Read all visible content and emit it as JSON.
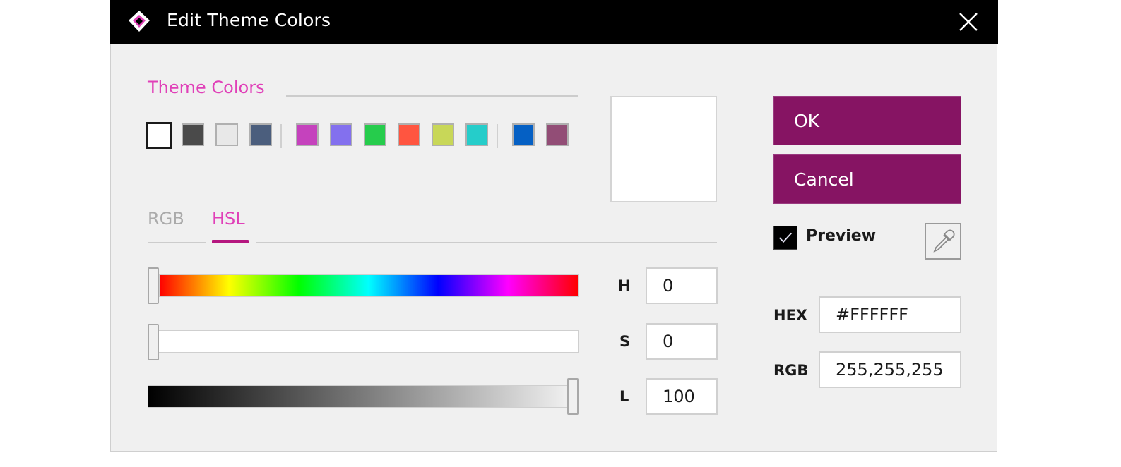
{
  "window": {
    "title": "Edit Theme Colors",
    "logo_icon": "diamond-logo-icon",
    "close_icon": "close-icon"
  },
  "theme_colors": {
    "label": "Theme Colors",
    "groups": [
      [
        {
          "name": "white",
          "color": "#FFFFFF",
          "selected": true
        },
        {
          "name": "dark-gray",
          "color": "#4A4A4A",
          "selected": false
        },
        {
          "name": "light-gray",
          "color": "#E8E8E8",
          "selected": false
        },
        {
          "name": "slate-blue",
          "color": "#4B5E7D",
          "selected": false
        }
      ],
      [
        {
          "name": "magenta",
          "color": "#C542BD",
          "selected": false
        },
        {
          "name": "lavender",
          "color": "#8370EE",
          "selected": false
        },
        {
          "name": "green",
          "color": "#26CC4C",
          "selected": false
        },
        {
          "name": "red-orange",
          "color": "#FF5540",
          "selected": false
        },
        {
          "name": "yellow-green",
          "color": "#C8D758",
          "selected": false
        },
        {
          "name": "turquoise",
          "color": "#25CDCA",
          "selected": false
        }
      ],
      [
        {
          "name": "blue",
          "color": "#0560C4",
          "selected": false
        },
        {
          "name": "plum",
          "color": "#924D76",
          "selected": false
        }
      ]
    ]
  },
  "preview_color": "#FFFFFF",
  "tabs": [
    {
      "label": "RGB",
      "active": false
    },
    {
      "label": "HSL",
      "active": true
    }
  ],
  "hsl": {
    "h": {
      "label": "H",
      "value": "0",
      "max": 360
    },
    "s": {
      "label": "S",
      "value": "0",
      "max": 100
    },
    "l": {
      "label": "L",
      "value": "100",
      "max": 100
    }
  },
  "buttons": {
    "ok": "OK",
    "cancel": "Cancel"
  },
  "preview_checkbox": {
    "label": "Preview",
    "checked": true
  },
  "eyedropper_icon": "eyedropper-icon",
  "hex": {
    "label": "HEX",
    "value": "#FFFFFF"
  },
  "rgb": {
    "label": "RGB",
    "value": "255,255,255"
  },
  "colors": {
    "accent": "#861463",
    "accent_text": "#E040B8",
    "titlebar": "#000000",
    "dialog_bg": "#F0F0F0"
  }
}
